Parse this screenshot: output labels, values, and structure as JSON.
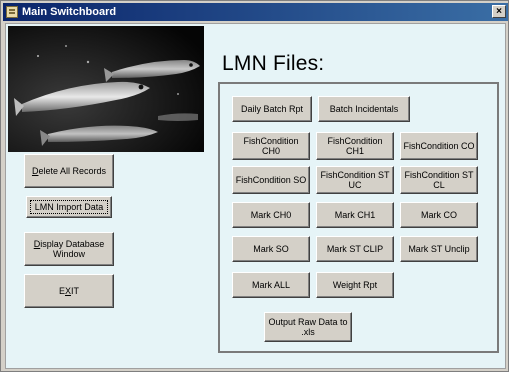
{
  "window": {
    "title": "Main Switchboard",
    "close_glyph": "×"
  },
  "main": {
    "heading": "LMN Files:"
  },
  "side_buttons": [
    {
      "label": "elete All Records",
      "mnemonic": "D"
    },
    {
      "label": "LMN Import Data",
      "mnemonic": ""
    },
    {
      "label": "isplay Database\nWindow",
      "mnemonic": "D"
    },
    {
      "label": "E",
      "label_rest": "IT",
      "mnemonic": "X"
    }
  ],
  "panel_buttons": [
    "Daily Batch Rpt",
    "Batch Incidentals",
    "FishCondition\nCH0",
    "FishCondition\nCH1",
    "FishCondition CO",
    "FishCondition SO",
    "FishCondition ST\nUC",
    "FishCondition ST\nCL",
    "Mark CH0",
    "Mark CH1",
    "Mark CO",
    "Mark SO",
    "Mark ST CLIP",
    "Mark ST Unclip",
    "Mark ALL",
    "Weight Rpt",
    "Output Raw Data to\n.xls"
  ],
  "colors": {
    "client_bg": "#e6f4f7",
    "title_start": "#0a246a",
    "title_end": "#3a6ea5",
    "button_face": "#d4d0c8"
  },
  "icons": [
    "app-icon",
    "close-icon"
  ]
}
